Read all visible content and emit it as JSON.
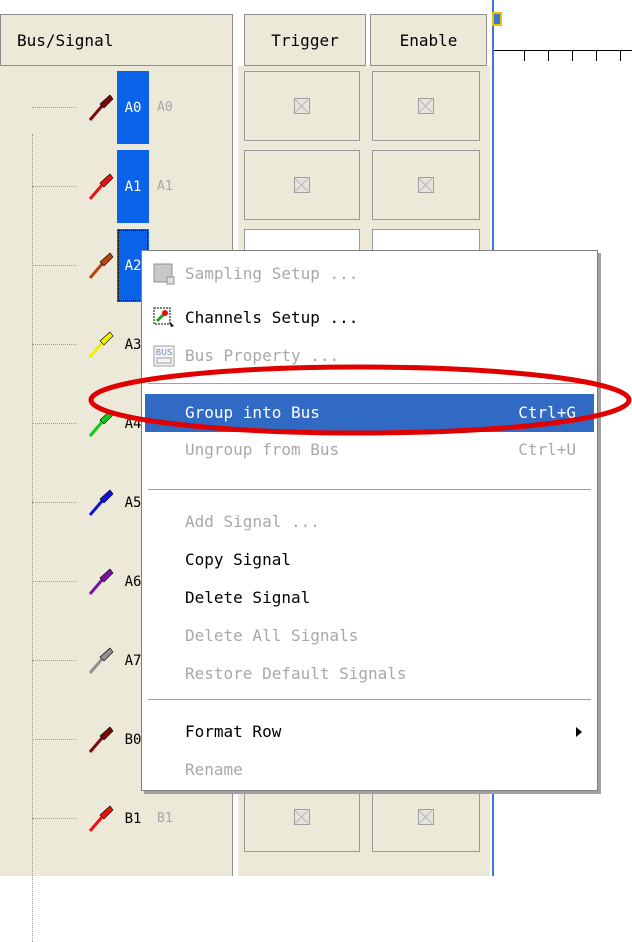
{
  "columns": {
    "signal": "Bus/Signal",
    "trigger": "Trigger",
    "enable": "Enable"
  },
  "signals": [
    {
      "label": "A0",
      "alias": "A0",
      "color": "#7a0a0a",
      "selected": true
    },
    {
      "label": "A1",
      "alias": "A1",
      "color": "#ee1010",
      "selected": true
    },
    {
      "label": "A2",
      "alias": "",
      "color": "#b8450f",
      "selected": true
    },
    {
      "label": "A3",
      "alias": "",
      "color": "#f0f000",
      "selected": false
    },
    {
      "label": "A4",
      "alias": "",
      "color": "#10cc10",
      "selected": false
    },
    {
      "label": "A5",
      "alias": "",
      "color": "#1010e0",
      "selected": false
    },
    {
      "label": "A6",
      "alias": "",
      "color": "#8010a0",
      "selected": false
    },
    {
      "label": "A7",
      "alias": "",
      "color": "#909090",
      "selected": false
    },
    {
      "label": "B0",
      "alias": "",
      "color": "#7a0a0a",
      "selected": false
    },
    {
      "label": "B1",
      "alias": "B1",
      "color": "#ee1010",
      "selected": false
    }
  ],
  "context_menu": {
    "items": [
      {
        "label": "Sampling Setup ...",
        "shortcut": "",
        "enabled": false,
        "icon": "sampling-icon"
      },
      {
        "label": "Channels Setup ...",
        "shortcut": "",
        "enabled": true,
        "icon": "channels-icon"
      },
      {
        "label": "Bus Property ...",
        "shortcut": "",
        "enabled": false,
        "icon": "bus-icon"
      },
      {
        "label": "Group into Bus",
        "shortcut": "Ctrl+G",
        "enabled": true,
        "highlighted": true
      },
      {
        "label": "Ungroup from Bus",
        "shortcut": "Ctrl+U",
        "enabled": false
      },
      {
        "label": "Add Signal ...",
        "shortcut": "",
        "enabled": false
      },
      {
        "label": "Copy Signal",
        "shortcut": "",
        "enabled": true
      },
      {
        "label": "Delete Signal",
        "shortcut": "",
        "enabled": true
      },
      {
        "label": "Delete All Signals",
        "shortcut": "",
        "enabled": false
      },
      {
        "label": "Restore Default Signals",
        "shortcut": "",
        "enabled": false
      },
      {
        "label": "Format Row",
        "shortcut": "",
        "enabled": true,
        "submenu": true
      },
      {
        "label": "Rename",
        "shortcut": "",
        "enabled": false
      }
    ]
  },
  "colors": {
    "selection": "#0a62e8",
    "menu_highlight": "#316ac5",
    "annotation": "#e00000",
    "panel": "#ece9d8"
  }
}
